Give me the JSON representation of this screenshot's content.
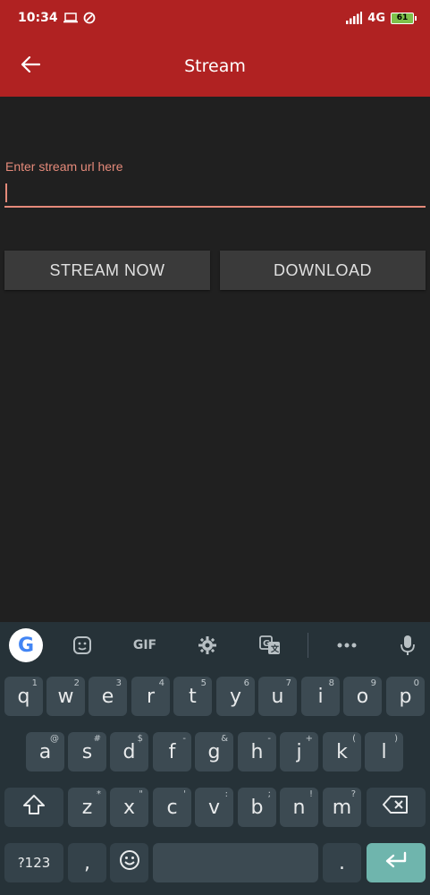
{
  "status_bar": {
    "time": "10:34",
    "network": "4G",
    "battery_level": "61"
  },
  "app_bar": {
    "title": "Stream",
    "back_icon": "arrow-back-icon"
  },
  "form": {
    "url_label": "Enter stream url here",
    "url_value": "",
    "stream_button": "STREAM NOW",
    "download_button": "DOWNLOAD"
  },
  "keyboard": {
    "toolbar": {
      "google": "G",
      "sticker_icon": "sticker-icon",
      "gif": "GIF",
      "settings_icon": "gear-icon",
      "translate_icon": "translate-icon",
      "more_icon": "more-icon",
      "mic_icon": "mic-icon"
    },
    "row1": [
      {
        "key": "q",
        "alt": "1"
      },
      {
        "key": "w",
        "alt": "2"
      },
      {
        "key": "e",
        "alt": "3"
      },
      {
        "key": "r",
        "alt": "4"
      },
      {
        "key": "t",
        "alt": "5"
      },
      {
        "key": "y",
        "alt": "6"
      },
      {
        "key": "u",
        "alt": "7"
      },
      {
        "key": "i",
        "alt": "8"
      },
      {
        "key": "o",
        "alt": "9"
      },
      {
        "key": "p",
        "alt": "0"
      }
    ],
    "row2": [
      {
        "key": "a",
        "alt": "@"
      },
      {
        "key": "s",
        "alt": "#"
      },
      {
        "key": "d",
        "alt": "$"
      },
      {
        "key": "f",
        "alt": "-"
      },
      {
        "key": "g",
        "alt": "&"
      },
      {
        "key": "h",
        "alt": "-"
      },
      {
        "key": "j",
        "alt": "+"
      },
      {
        "key": "k",
        "alt": "("
      },
      {
        "key": "l",
        "alt": ")"
      }
    ],
    "row3": [
      {
        "key": "z",
        "alt": "*"
      },
      {
        "key": "x",
        "alt": "\""
      },
      {
        "key": "c",
        "alt": "'"
      },
      {
        "key": "v",
        "alt": ":"
      },
      {
        "key": "b",
        "alt": ";"
      },
      {
        "key": "n",
        "alt": "!"
      },
      {
        "key": "m",
        "alt": "?"
      }
    ],
    "bottom": {
      "symbols": "?123",
      "comma": ",",
      "period": "."
    }
  }
}
